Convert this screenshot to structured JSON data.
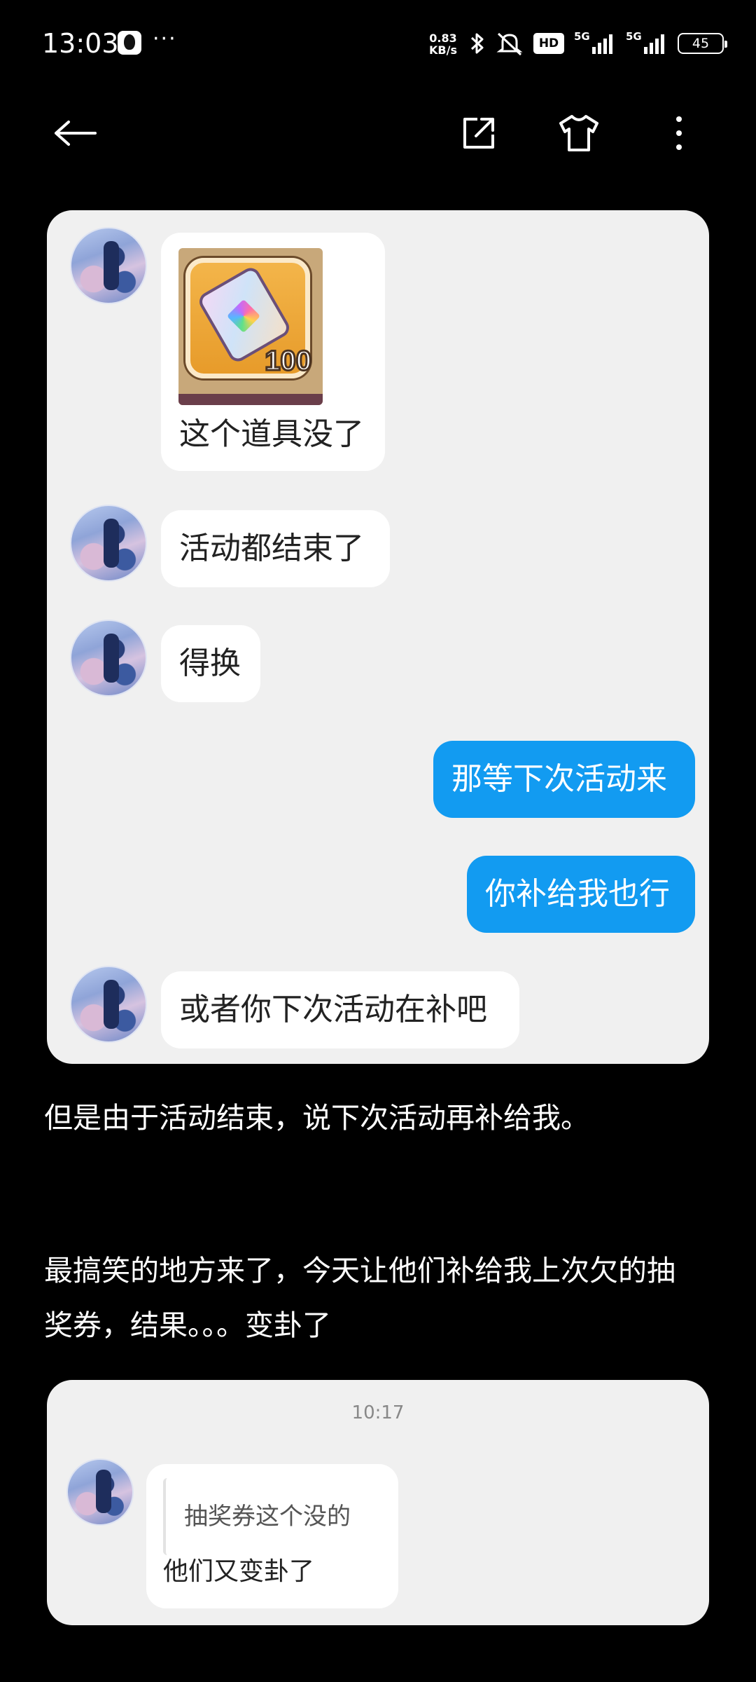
{
  "status_bar": {
    "time": "13:03",
    "net_speed_value": "0.83",
    "net_speed_unit": "KB/s",
    "hd_label": "HD",
    "signal1_label": "5G",
    "signal2_label": "5G",
    "battery_level": "45"
  },
  "card1": {
    "messages": [
      {
        "side": "left",
        "text": "这个道具没了",
        "has_image": true,
        "image_qty": "100"
      },
      {
        "side": "left",
        "text": "活动都结束了"
      },
      {
        "side": "left",
        "text": "得换"
      },
      {
        "side": "right",
        "text": "那等下次活动来"
      },
      {
        "side": "right",
        "text": "你补给我也行"
      },
      {
        "side": "left",
        "text": "或者你下次活动在补吧"
      }
    ]
  },
  "post": {
    "paragraph1": "但是由于活动结束，说下次活动再补给我。",
    "paragraph2_line1": "最搞笑的地方来了，今天让他们补给我上次欠的抽",
    "paragraph2_line2": "奖券，结果。。。变卦了"
  },
  "card2": {
    "time": "10:17",
    "quoted_text": "抽奖券这个没的",
    "reply_text": "他们又变卦了"
  },
  "colors": {
    "background": "#000000",
    "card_background": "#f0f0f0",
    "sent_bubble": "#129bf1",
    "received_bubble": "#ffffff"
  }
}
